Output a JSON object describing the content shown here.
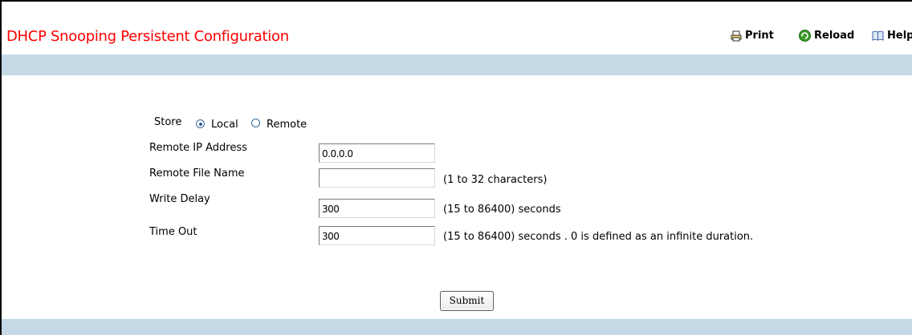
{
  "header": {
    "title": "DHCP Snooping Persistent Configuration",
    "print_label": "Print",
    "reload_label": "Reload",
    "help_label": "Help"
  },
  "form": {
    "store": {
      "label": "Store",
      "options": [
        "Local",
        "Remote"
      ],
      "selected": "Local"
    },
    "remote_ip": {
      "label": "Remote IP Address",
      "value": "0.0.0.0"
    },
    "remote_file": {
      "label": "Remote File Name",
      "value": "",
      "hint": "(1 to 32 characters)"
    },
    "write_delay": {
      "label": "Write Delay",
      "value": "300",
      "hint": "(15 to 86400) seconds"
    },
    "time_out": {
      "label": "Time Out",
      "value": "300",
      "hint": "(15 to 86400) seconds . 0 is defined as an infinite duration."
    },
    "submit_label": "Submit"
  },
  "colors": {
    "title": "#ff0000",
    "band": "#c5d9e6"
  },
  "icons": {
    "print": "printer-icon",
    "reload": "reload-icon",
    "help": "help-book-icon"
  }
}
